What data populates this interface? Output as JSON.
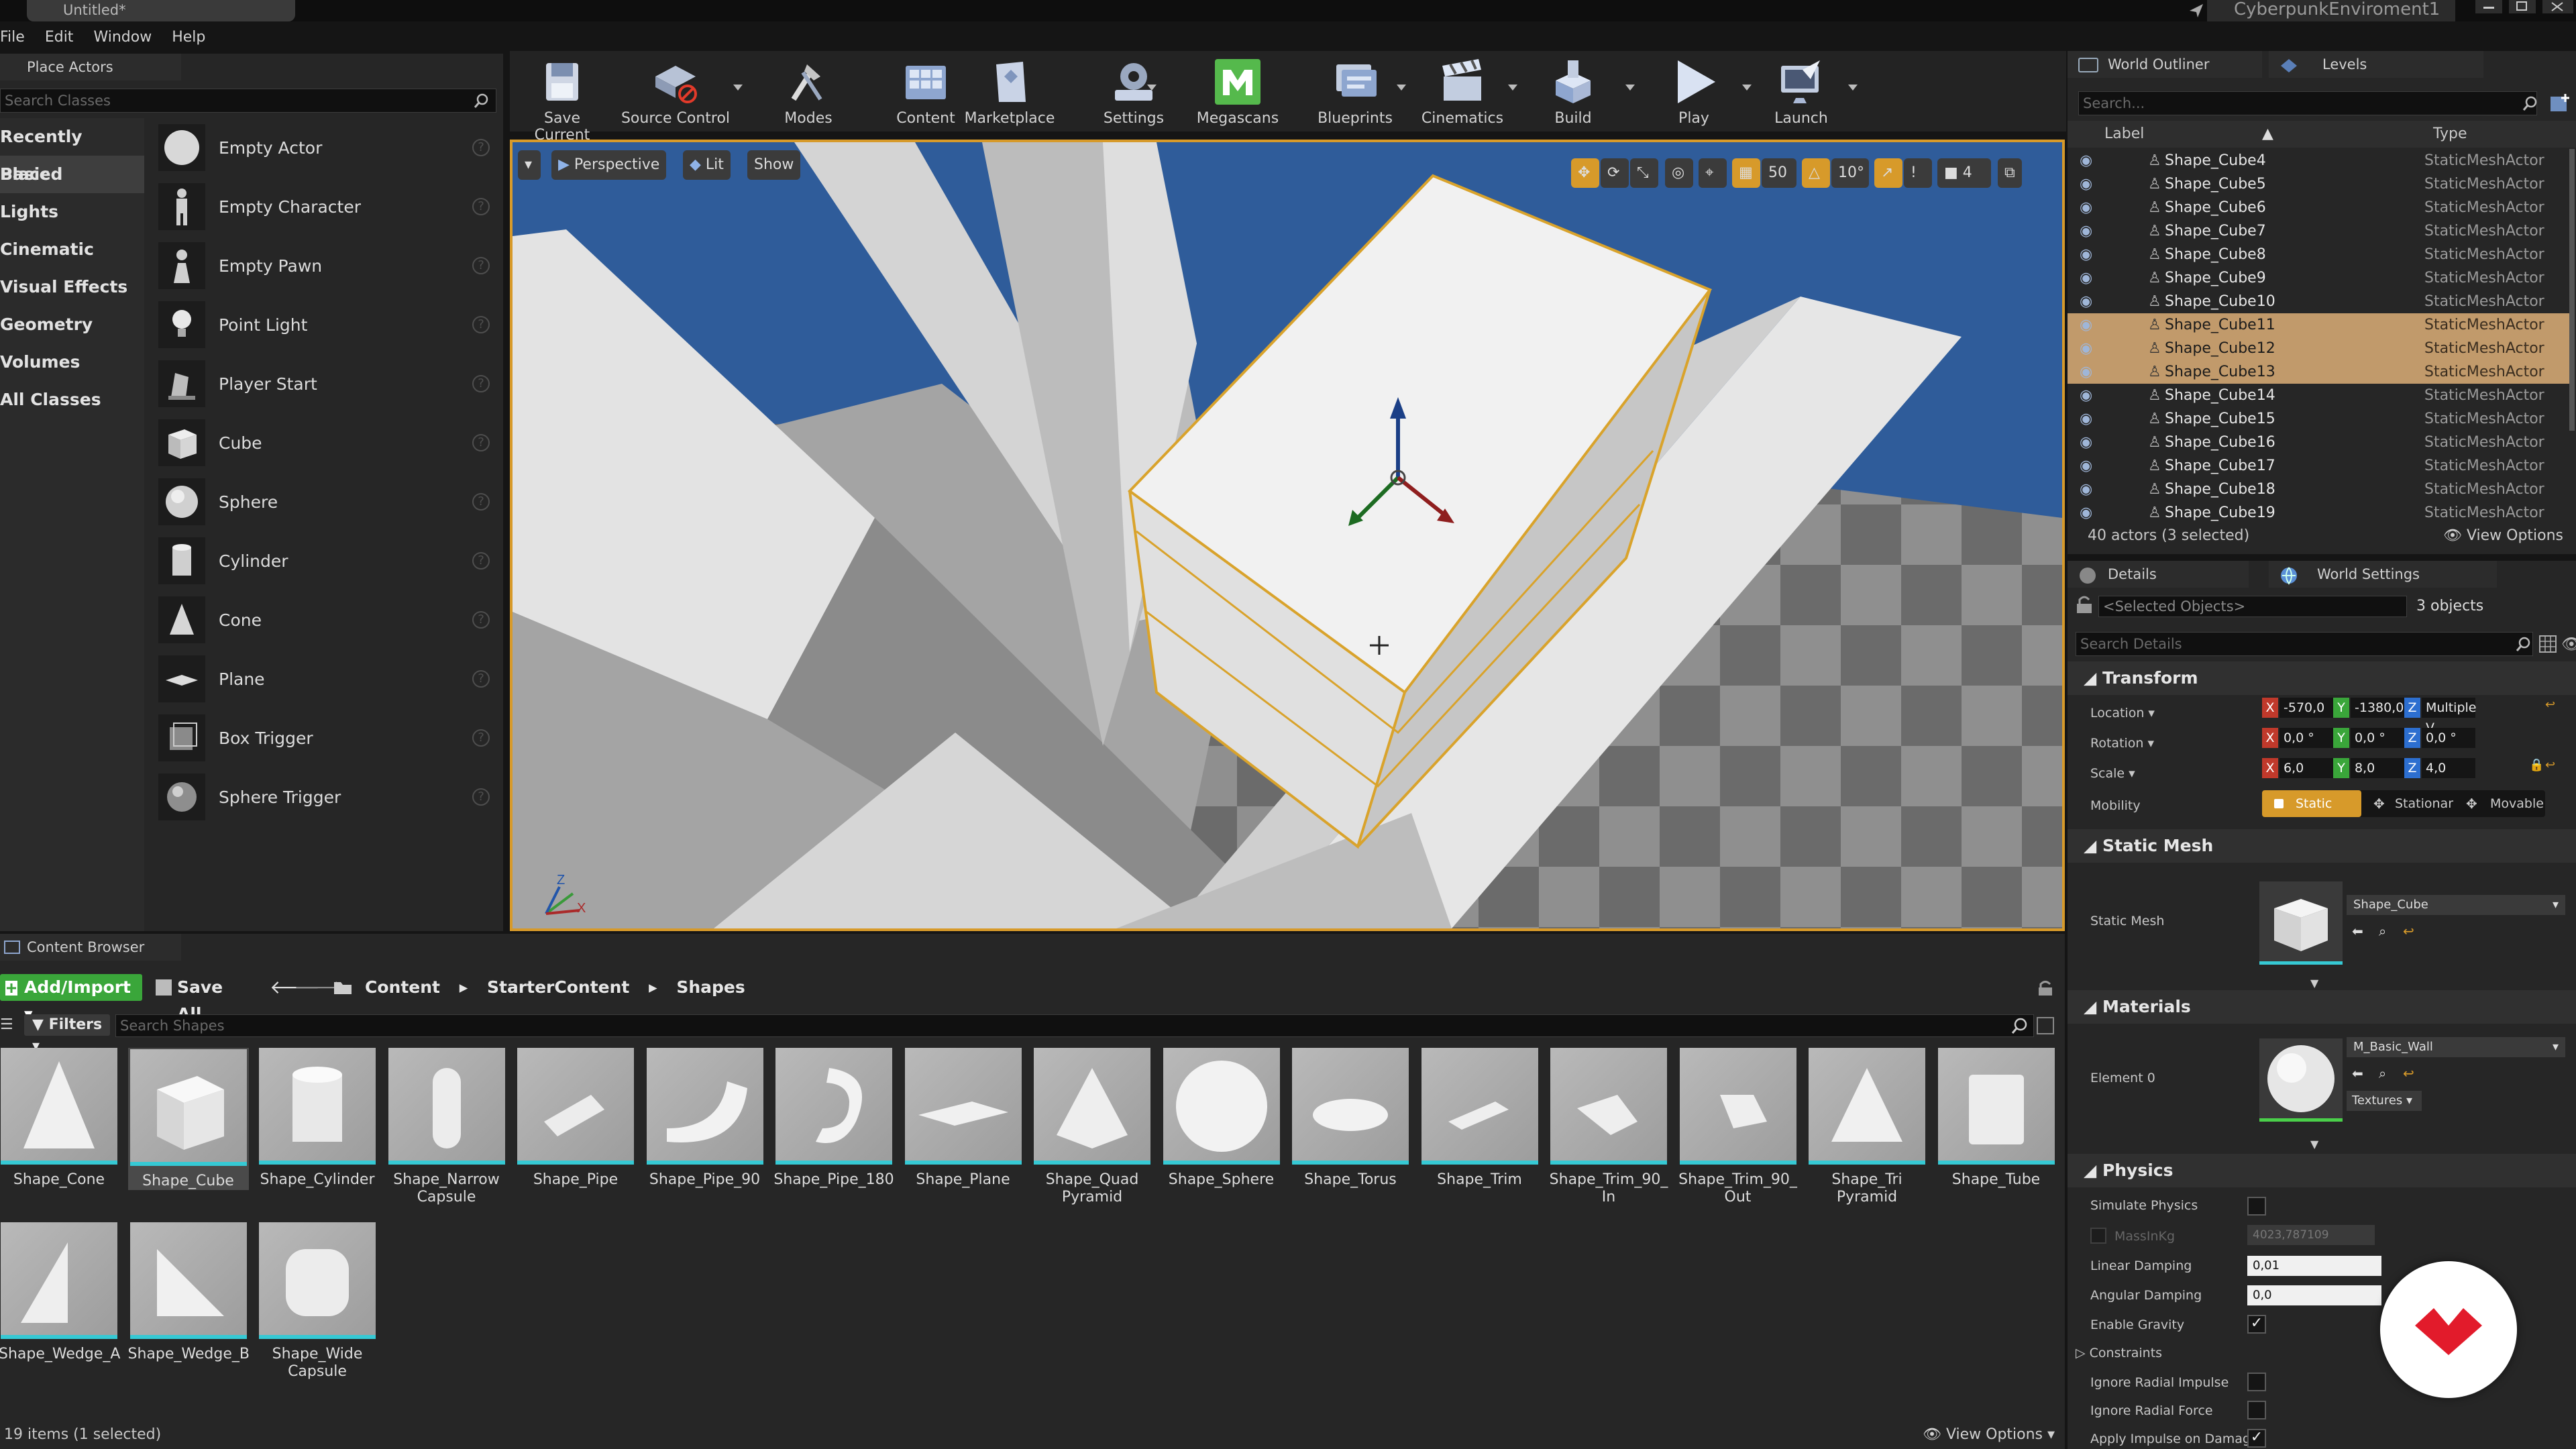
{
  "app": {
    "tab_title": "Untitled*",
    "project": "CyberpunkEnviroment1"
  },
  "menu": [
    "File",
    "Edit",
    "Window",
    "Help"
  ],
  "place_actors": {
    "tab": "Place Actors",
    "search_placeholder": "Search Classes",
    "categories": [
      "Recently Placed",
      "Basic",
      "Lights",
      "Cinematic",
      "Visual Effects",
      "Geometry",
      "Volumes",
      "All Classes"
    ],
    "actors": [
      "Empty Actor",
      "Empty Character",
      "Empty Pawn",
      "Point Light",
      "Player Start",
      "Cube",
      "Sphere",
      "Cylinder",
      "Cone",
      "Plane",
      "Box Trigger",
      "Sphere Trigger"
    ]
  },
  "toolbar": [
    "Save Current",
    "Source Control",
    "Modes",
    "Content",
    "Marketplace",
    "Settings",
    "Megascans",
    "Blueprints",
    "Cinematics",
    "Build",
    "Play",
    "Launch"
  ],
  "viewport": {
    "perspective": "Perspective",
    "lit": "Lit",
    "show": "Show",
    "grid": "50",
    "angle": "10°",
    "camera_speed": "4"
  },
  "outliner": {
    "tabs": [
      "World Outliner",
      "Levels"
    ],
    "search_placeholder": "Search...",
    "col_label": "Label",
    "col_type": "Type",
    "rows": [
      {
        "label": "Shape_Cube4",
        "type": "StaticMeshActor",
        "selected": false
      },
      {
        "label": "Shape_Cube5",
        "type": "StaticMeshActor",
        "selected": false
      },
      {
        "label": "Shape_Cube6",
        "type": "StaticMeshActor",
        "selected": false
      },
      {
        "label": "Shape_Cube7",
        "type": "StaticMeshActor",
        "selected": false
      },
      {
        "label": "Shape_Cube8",
        "type": "StaticMeshActor",
        "selected": false
      },
      {
        "label": "Shape_Cube9",
        "type": "StaticMeshActor",
        "selected": false
      },
      {
        "label": "Shape_Cube10",
        "type": "StaticMeshActor",
        "selected": false
      },
      {
        "label": "Shape_Cube11",
        "type": "StaticMeshActor",
        "selected": true
      },
      {
        "label": "Shape_Cube12",
        "type": "StaticMeshActor",
        "selected": true
      },
      {
        "label": "Shape_Cube13",
        "type": "StaticMeshActor",
        "selected": true
      },
      {
        "label": "Shape_Cube14",
        "type": "StaticMeshActor",
        "selected": false
      },
      {
        "label": "Shape_Cube15",
        "type": "StaticMeshActor",
        "selected": false
      },
      {
        "label": "Shape_Cube16",
        "type": "StaticMeshActor",
        "selected": false
      },
      {
        "label": "Shape_Cube17",
        "type": "StaticMeshActor",
        "selected": false
      },
      {
        "label": "Shape_Cube18",
        "type": "StaticMeshActor",
        "selected": false
      },
      {
        "label": "Shape_Cube19",
        "type": "StaticMeshActor",
        "selected": false
      }
    ],
    "status": "40 actors (3 selected)",
    "view_options": "View Options"
  },
  "details": {
    "tabs": [
      "Details",
      "World Settings"
    ],
    "selected_objects_placeholder": "<Selected Objects>",
    "count": "3 objects",
    "search_placeholder": "Search Details",
    "transform": {
      "title": "Transform",
      "location_label": "Location",
      "rotation_label": "Rotation",
      "scale_label": "Scale",
      "mobility_label": "Mobility",
      "location": [
        "-570,0",
        "-1380,0",
        "Multiple V"
      ],
      "rotation": [
        "0,0 °",
        "0,0 °",
        "0,0 °"
      ],
      "scale": [
        "6,0",
        "8,0",
        "4,0"
      ],
      "mobility": [
        "Static",
        "Stationar",
        "Movable"
      ]
    },
    "static_mesh": {
      "title": "Static Mesh",
      "label": "Static Mesh",
      "value": "Shape_Cube"
    },
    "materials": {
      "title": "Materials",
      "label": "Element 0",
      "value": "M_Basic_Wall",
      "textures": "Textures"
    },
    "physics": {
      "title": "Physics",
      "simulate": "Simulate Physics",
      "mass": "MassInKg",
      "mass_value": "4023,787109",
      "linear": "Linear Damping",
      "linear_value": "0,01",
      "angular": "Angular Damping",
      "angular_value": "0,0",
      "gravity": "Enable Gravity",
      "constraints": "Constraints",
      "radial_impulse": "Ignore Radial Impulse",
      "radial_force": "Ignore Radial Force",
      "apply_impulse": "Apply Impulse on Damage"
    }
  },
  "content_browser": {
    "tab": "Content Browser",
    "add_import": "Add/Import",
    "save_all": "Save All",
    "path": [
      "Content",
      "StarterContent",
      "Shapes"
    ],
    "filters": "Filters",
    "search_placeholder": "Search Shapes",
    "assets": [
      "Shape_Cone",
      "Shape_Cube",
      "Shape_Cylinder",
      "Shape_Narrow Capsule",
      "Shape_Pipe",
      "Shape_Pipe_90",
      "Shape_Pipe_180",
      "Shape_Plane",
      "Shape_Quad Pyramid",
      "Shape_Sphere",
      "Shape_Torus",
      "Shape_Trim",
      "Shape_Trim_90_ In",
      "Shape_Trim_90_ Out",
      "Shape_Tri Pyramid",
      "Shape_Tube",
      "Shape_Wedge_A",
      "Shape_Wedge_B",
      "Shape_Wide Capsule"
    ],
    "status": "19 items (1 selected)",
    "view_options": "View Options"
  },
  "colors": {
    "selection": "#c19a6b",
    "accent": "#d79a2a",
    "add_green": "#3aa63a",
    "brand_red": "#e21b2b"
  }
}
